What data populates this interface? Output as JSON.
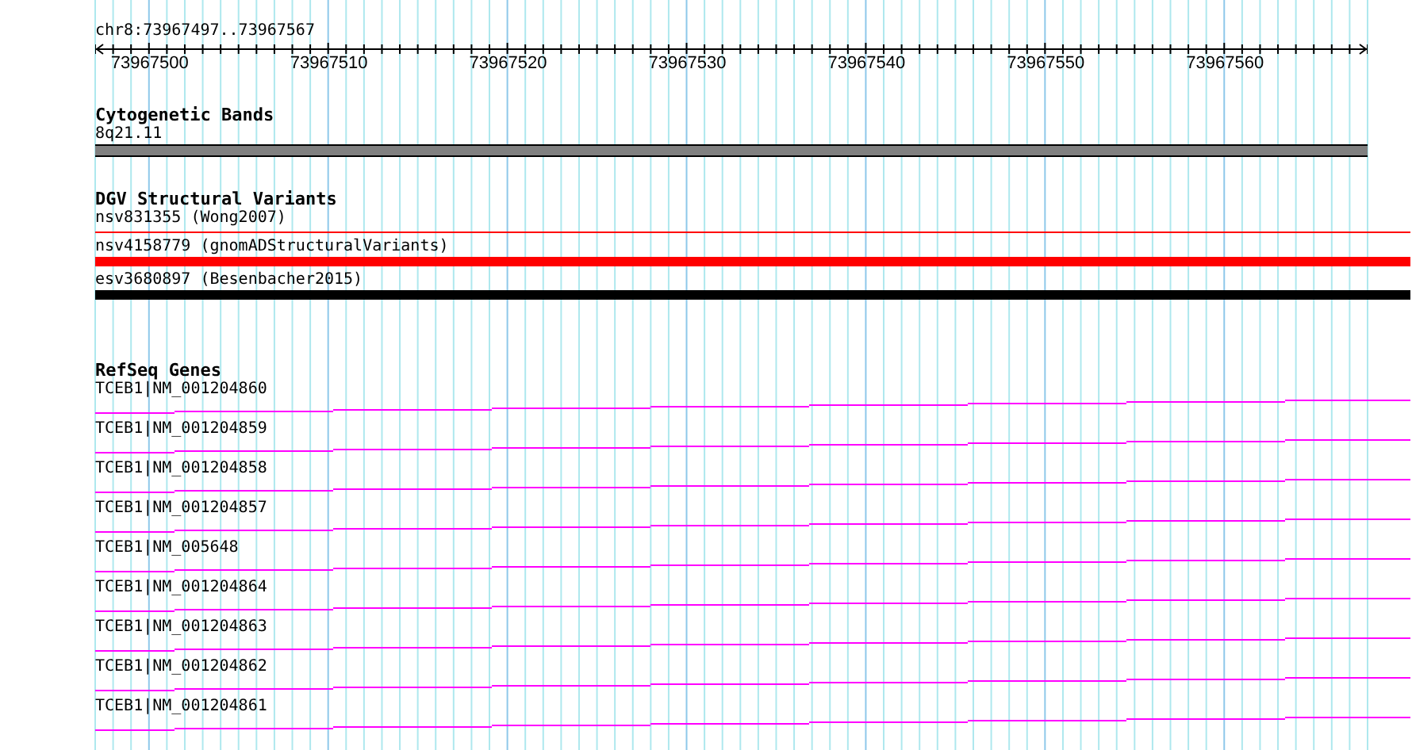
{
  "ruler": {
    "label": "chr8:73967497..73967567",
    "ticks": [
      "73967500",
      "73967510",
      "73967520",
      "73967530",
      "73967540",
      "73967550",
      "73967560"
    ]
  },
  "tracks": [
    {
      "title": "Cytogenetic Bands",
      "features": [
        {
          "label": "8q21.11",
          "kind": "band",
          "color": "#808080"
        }
      ]
    },
    {
      "title": "DGV Structural Variants",
      "features": [
        {
          "label": "nsv831355 (Wong2007)",
          "kind": "line",
          "color": "#ff0000"
        },
        {
          "label": "nsv4158779 (gnomADStructuralVariants)",
          "kind": "bar",
          "color": "#ff0000"
        },
        {
          "label": "esv3680897 (Besenbacher2015)",
          "kind": "bar",
          "color": "#000000"
        }
      ]
    },
    {
      "title": "RefSeq Genes",
      "features": [
        {
          "label": "TCEB1|NM_001204860",
          "kind": "gene",
          "color": "#ff00ff"
        },
        {
          "label": "TCEB1|NM_001204859",
          "kind": "gene",
          "color": "#ff00ff"
        },
        {
          "label": "TCEB1|NM_001204858",
          "kind": "gene",
          "color": "#ff00ff"
        },
        {
          "label": "TCEB1|NM_001204857",
          "kind": "gene",
          "color": "#ff00ff"
        },
        {
          "label": "TCEB1|NM_005648",
          "kind": "gene",
          "color": "#ff00ff"
        },
        {
          "label": "TCEB1|NM_001204864",
          "kind": "gene",
          "color": "#ff00ff"
        },
        {
          "label": "TCEB1|NM_001204863",
          "kind": "gene",
          "color": "#ff00ff"
        },
        {
          "label": "TCEB1|NM_001204862",
          "kind": "gene",
          "color": "#ff00ff"
        },
        {
          "label": "TCEB1|NM_001204861",
          "kind": "gene",
          "color": "#ff00ff"
        }
      ]
    }
  ]
}
